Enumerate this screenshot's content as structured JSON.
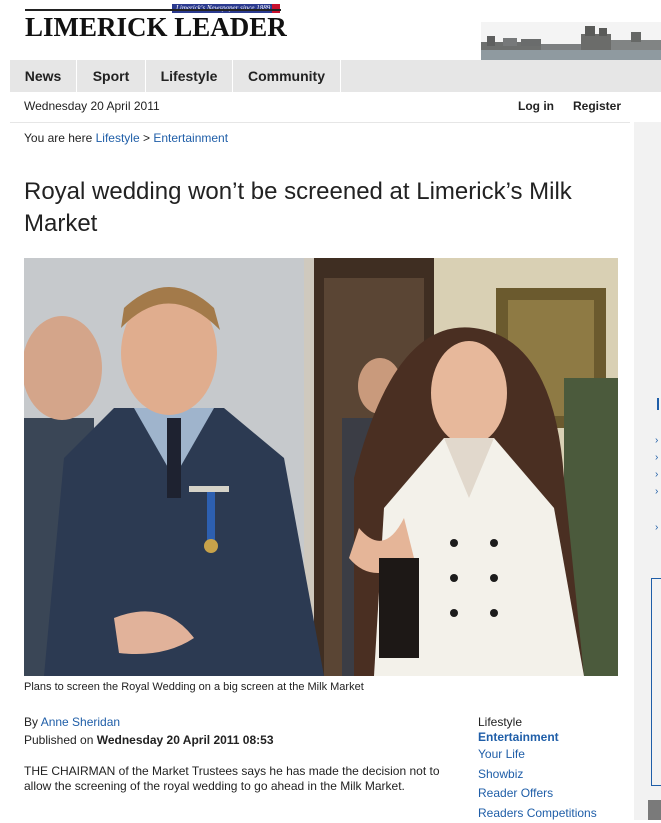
{
  "masthead": {
    "tagline": "Limerick's Newspaper since 1889",
    "logo": "LIMERICK LEADER"
  },
  "nav": {
    "items": [
      "News",
      "Sport",
      "Lifestyle",
      "Community"
    ]
  },
  "datebar": {
    "date": "Wednesday 20 April 2011",
    "login": "Log in",
    "register": "Register"
  },
  "breadcrumb": {
    "prefix": "You are here",
    "items": [
      "Lifestyle",
      "Entertainment"
    ],
    "separator": ">"
  },
  "article": {
    "title": "Royal wedding won’t be screened at Limerick’s Milk Market",
    "caption": "Plans to screen the Royal Wedding on a big screen at the Milk Market",
    "by_label": "By",
    "author": "Anne Sheridan",
    "published_label": "Published on",
    "published_date": "Wednesday 20 April 2011 08:53",
    "body": "THE CHAIRMAN of the Market Trustees says he has made the decision not to allow the screening of the royal wedding to go ahead in the Milk Market."
  },
  "related": {
    "label": "Lifestyle",
    "items": [
      "Entertainment",
      "Your Life",
      "Showbiz",
      "Reader Offers",
      "Readers Competitions"
    ]
  },
  "colors": {
    "link": "#1f5ea8",
    "nav_bg": "#e6e6e6",
    "tagline_bg": "#2b3a8f"
  }
}
